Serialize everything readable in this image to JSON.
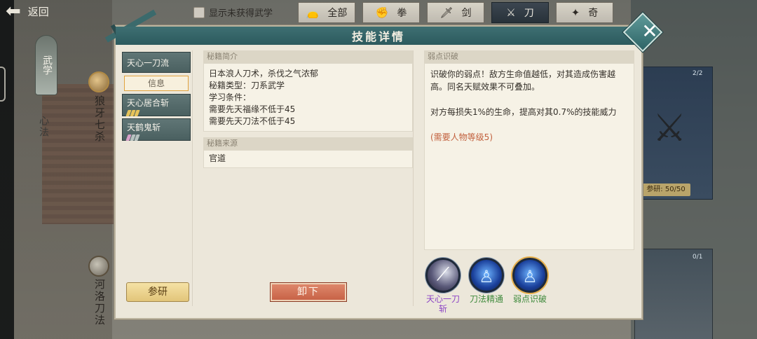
{
  "topbar": {
    "back_label": "返回",
    "show_unowned_label": "显示未获得武学",
    "filters": [
      {
        "label": "全部",
        "icon": "bag-icon",
        "active": false
      },
      {
        "label": "拳",
        "icon": "fist-icon",
        "active": false
      },
      {
        "label": "剑",
        "icon": "sword-icon",
        "active": false
      },
      {
        "label": "刀",
        "icon": "blade-icon",
        "active": true
      },
      {
        "label": "奇",
        "icon": "shuriken-icon",
        "active": false
      }
    ]
  },
  "sidebar": {
    "tab_label": "武学",
    "xinfa_label": "心法"
  },
  "background": {
    "skill1_label": "狼牙七杀",
    "skill2_label": "河洛刀法",
    "research_label": "参研: 50/50",
    "count1": "2/2",
    "count2": "0/1"
  },
  "dialog": {
    "title": "技能详情",
    "skills": [
      {
        "name": "天心一刀流",
        "dots": []
      },
      {
        "name": "天心居合斩",
        "dots": [
          "on",
          "on",
          "on"
        ]
      },
      {
        "name": "天鹤鬼斩",
        "dots": [
          "pink",
          "off",
          "off"
        ]
      }
    ],
    "info_tab_label": "信息",
    "research_button": "参研",
    "intro": {
      "header": "秘籍简介",
      "line1": "日本浪人刀术，杀伐之气浓郁",
      "line2": "秘籍类型：刀系武学",
      "line3": "学习条件：",
      "line4": "需要先天福缘不低于45",
      "line5": "需要先天刀法不低于45"
    },
    "source": {
      "header": "秘籍来源",
      "value": "官道"
    },
    "unload_button": "卸下",
    "talent_detail": {
      "header": "弱点识破",
      "desc1": "识破你的弱点！敌方生命值越低，对其造成伤害越高。同名天赋效果不可叠加。",
      "desc2": "对方每损失1%的生命，提高对其0.7%的技能威力",
      "requirement": "(需要人物等级5)"
    },
    "talents": [
      {
        "label": "天心一刀斩",
        "icon": "blade-slash-icon",
        "color": "#8d46c5"
      },
      {
        "label": "刀法精通",
        "icon": "warrior-icon",
        "color": "#3f8a3c"
      },
      {
        "label": "弱点识破",
        "icon": "warrior-icon",
        "color": "#3f8a3c",
        "selected": true
      }
    ]
  }
}
